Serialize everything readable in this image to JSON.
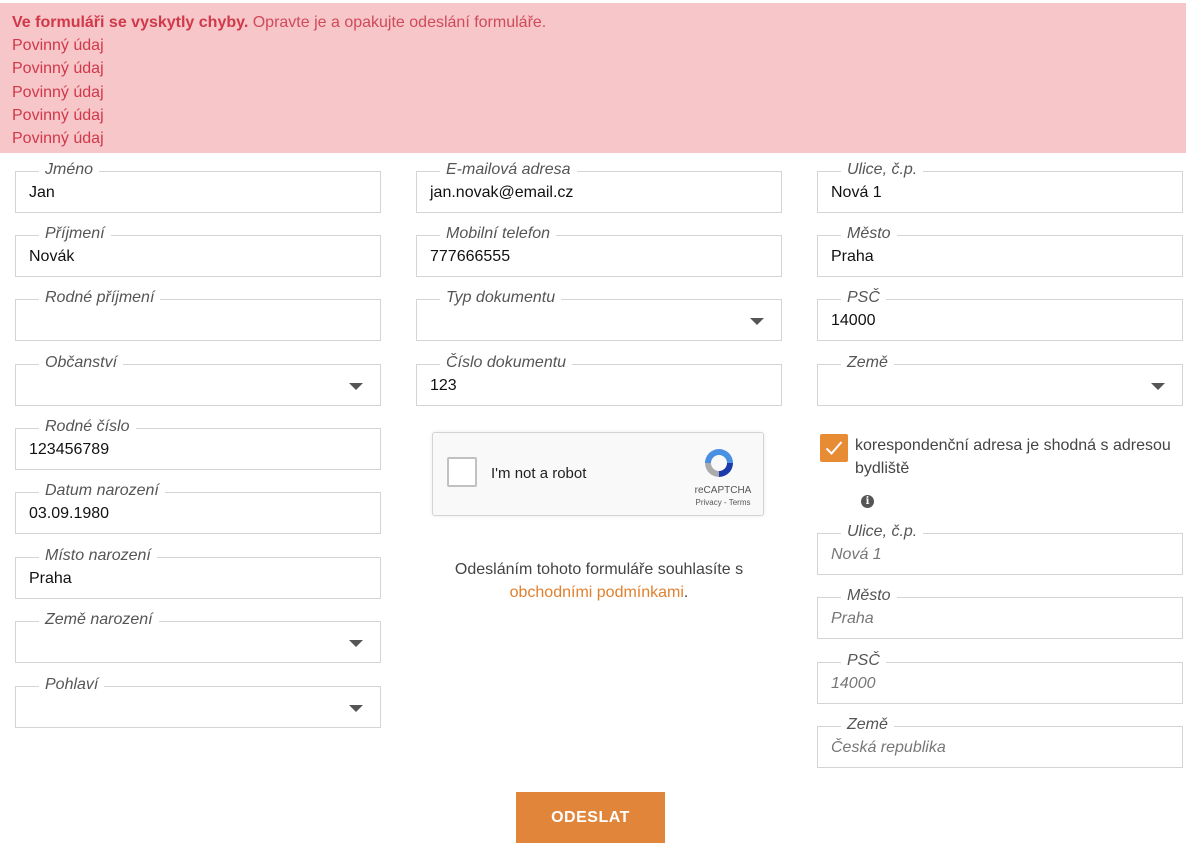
{
  "errors": {
    "heading": "Ve formuláři se vyskytly chyby.",
    "message": "Opravte je a opakujte odeslání formuláře.",
    "items": [
      "Povinný údaj",
      "Povinný údaj",
      "Povinný údaj",
      "Povinný údaj",
      "Povinný údaj"
    ]
  },
  "col1": [
    {
      "label": "Jméno",
      "value": "Jan"
    },
    {
      "label": "Příjmení",
      "value": "Novák"
    },
    {
      "label": "Rodné příjmení",
      "value": ""
    },
    {
      "label": "Občanství",
      "value": ""
    },
    {
      "label": "Rodné číslo",
      "value": "123456789"
    },
    {
      "label": "Datum narození",
      "value": "03.09.1980"
    },
    {
      "label": "Místo narození",
      "value": "Praha"
    },
    {
      "label": "Země narození",
      "value": ""
    },
    {
      "label": "Pohlaví",
      "value": ""
    }
  ],
  "col2": [
    {
      "label": "E-mailová adresa",
      "value": "jan.novak@email.cz"
    },
    {
      "label": "Mobilní telefon",
      "value": "777666555"
    },
    {
      "label": "Typ dokumentu",
      "value": ""
    },
    {
      "label": "Číslo dokumentu",
      "value": "123"
    }
  ],
  "col3": [
    {
      "label": "Ulice, č.p.",
      "value": "Nová 1"
    },
    {
      "label": "Město",
      "value": "Praha"
    },
    {
      "label": "PSČ",
      "value": "14000"
    },
    {
      "label": "Země",
      "value": ""
    }
  ],
  "recaptcha": {
    "label": "I'm not a robot",
    "brand": "reCAPTCHA",
    "links": "Privacy - Terms"
  },
  "consent": {
    "text": "Odesláním tohoto formuláře souhlasíte s",
    "link": "obchodními podmínkami",
    "suffix": "."
  },
  "correspondence": {
    "checkbox_label": "korespondenční adresa je shodná s adresou bydliště",
    "checked": true,
    "fields": [
      {
        "label": "Ulice, č.p.",
        "value": "Nová 1"
      },
      {
        "label": "Město",
        "value": "Praha"
      },
      {
        "label": "PSČ",
        "value": "14000"
      },
      {
        "label": "Země",
        "value": "Česká republika"
      }
    ]
  },
  "submit_label": "ODESLAT",
  "colors": {
    "accent": "#e0853a",
    "error_bg": "#f6c6c9",
    "error_text": "#d1384a"
  }
}
